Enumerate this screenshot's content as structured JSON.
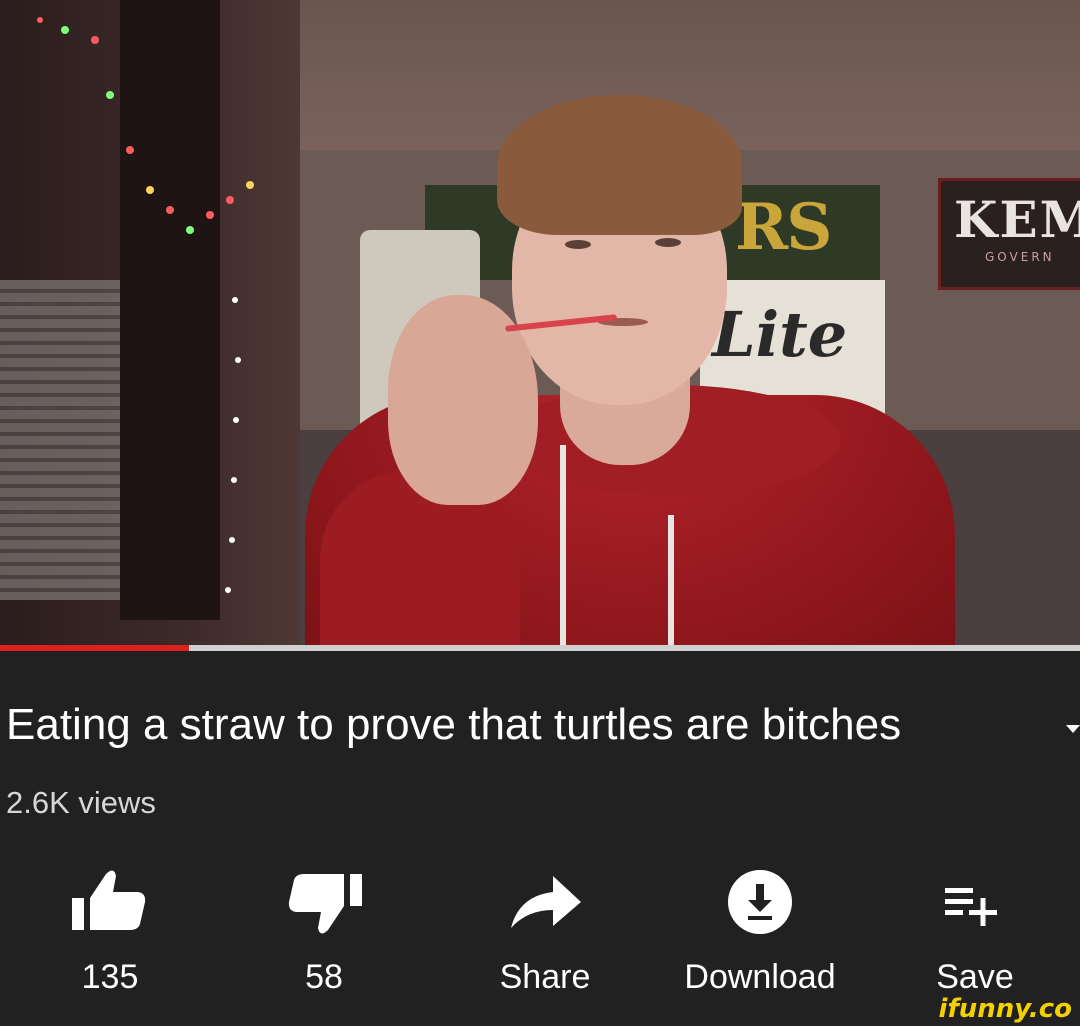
{
  "video": {
    "progress": 0.175,
    "scene_text": {
      "banner_main": "RS",
      "banner_lite": "Lite",
      "sign_main": "KEM",
      "sign_sub": "GOVERN"
    }
  },
  "title": "Eating a straw to prove that turtles are bitches",
  "views": "2.6K views",
  "actions": [
    {
      "icon": "thumbs-up-icon",
      "label": "135"
    },
    {
      "icon": "thumbs-down-icon",
      "label": "58"
    },
    {
      "icon": "share-icon",
      "label": "Share"
    },
    {
      "icon": "download-icon",
      "label": "Download"
    },
    {
      "icon": "save-playlist-icon",
      "label": "Save"
    }
  ],
  "watermark": "ifunny.co",
  "colors": {
    "background": "#212121",
    "progress_played": "#e01f1f",
    "progress_track": "#d0d0d0",
    "watermark": "#f5d000"
  }
}
